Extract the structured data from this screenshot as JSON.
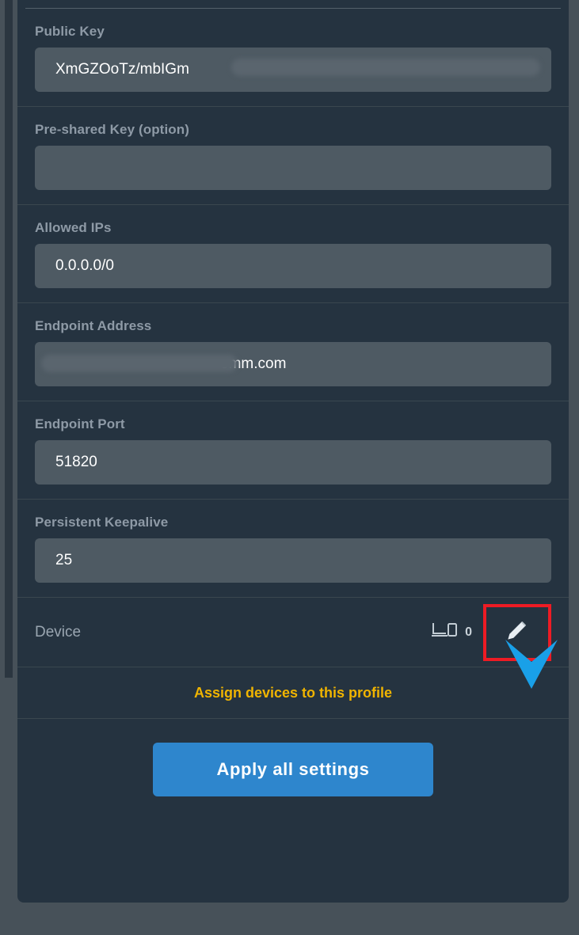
{
  "colors": {
    "page_background": "#475159",
    "card_background": "#253340",
    "input_background": "#4e5a63",
    "label_text": "#8e9aa6",
    "value_text": "#ffffff",
    "divider": "#3a474f",
    "accent_blue": "#2e86cd",
    "accent_yellow": "#f0b400",
    "highlight_red": "#ee1b24",
    "annotation_arrow": "#19a0e8",
    "scroll_thumb": "#2b3640"
  },
  "form": {
    "fields": [
      {
        "label": "Public Key",
        "value": "XmGZOoTz/mbIGm",
        "placeholder": "",
        "redacted": true
      },
      {
        "label": "Pre-shared Key (option)",
        "value": "",
        "placeholder": "",
        "redacted": false
      },
      {
        "label": "Allowed IPs",
        "value": "0.0.0.0/0",
        "placeholder": "",
        "redacted": false
      },
      {
        "label": "Endpoint Address",
        "value": "omm.com",
        "placeholder": "",
        "redacted": true
      },
      {
        "label": "Endpoint Port",
        "value": "51820",
        "placeholder": "",
        "redacted": false
      },
      {
        "label": "Persistent Keepalive",
        "value": "25",
        "placeholder": "",
        "redacted": false
      }
    ]
  },
  "device_row": {
    "label": "Device",
    "count": "0",
    "device_icon": "laptop-and-phone-icon",
    "edit_icon": "pencil-icon"
  },
  "assign": {
    "link_label": "Assign devices to this profile"
  },
  "apply": {
    "button_label": "Apply all settings"
  },
  "annotation": {
    "arrow_icon": "down-arrow-annotation",
    "highlight_target": "edit-device-button"
  }
}
